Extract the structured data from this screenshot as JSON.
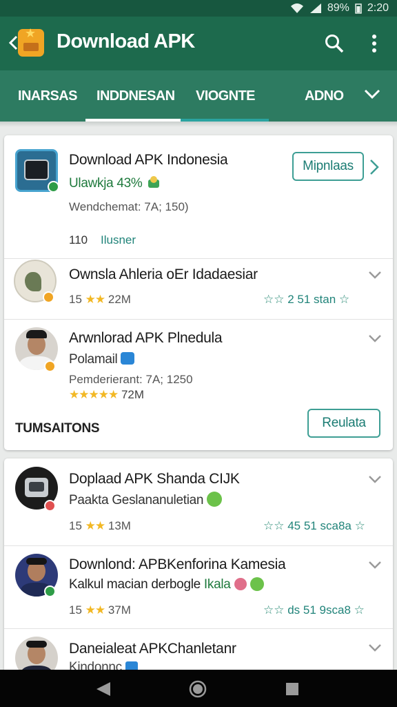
{
  "status_bar": {
    "battery": "89%",
    "time": "2:20"
  },
  "app_bar": {
    "title": "Download APK"
  },
  "tabs": [
    "INARSAS",
    "INDDNESAN",
    "VIOGNTE",
    "ADNO"
  ],
  "card1": {
    "item": {
      "title": "Download APK Indonesia",
      "subtitle": "Ulawkja 43%",
      "detail": "Wendchemat: 7A; 150)",
      "footer_number": "110",
      "footer_label": "Ilusner",
      "button": "Mipnlaas"
    },
    "rows": [
      {
        "title": "Ownsla Ahleria oEr Idadaesiar",
        "rating_prefix": "15",
        "size": "22M",
        "stars_text": "2 51 stan"
      },
      {
        "title": "Arwnlorad APK Plnedula",
        "subtitle": "Polamail",
        "detail": "Pemderierant: 7A; 1250",
        "size": "72M"
      }
    ],
    "section_label": "TUMSAITONS",
    "section_button": "Reulata"
  },
  "card2": {
    "rows": [
      {
        "title": "Doplaad APK Shanda CIJK",
        "subtitle": "Paakta Geslananuletian",
        "rating_prefix": "15",
        "size": "13M",
        "stars_text": "45 51 sca8a"
      },
      {
        "title": "Downlond: APBKenforina Kamesia",
        "subtitle_a": "Kalkul macian derbogle",
        "subtitle_b": "Ikala",
        "rating_prefix": "15",
        "size": "37M",
        "stars_text": "ds 51 9sca8"
      },
      {
        "title": "Daneialeat APKChanletanr",
        "subtitle": "Kindonnc"
      }
    ]
  },
  "colors": {
    "app_bar": "#1d6a4d",
    "tab_bar": "#2d7b61",
    "accent_green": "#1f7a3d",
    "accent_teal": "#21847a",
    "star": "#f2b824"
  }
}
